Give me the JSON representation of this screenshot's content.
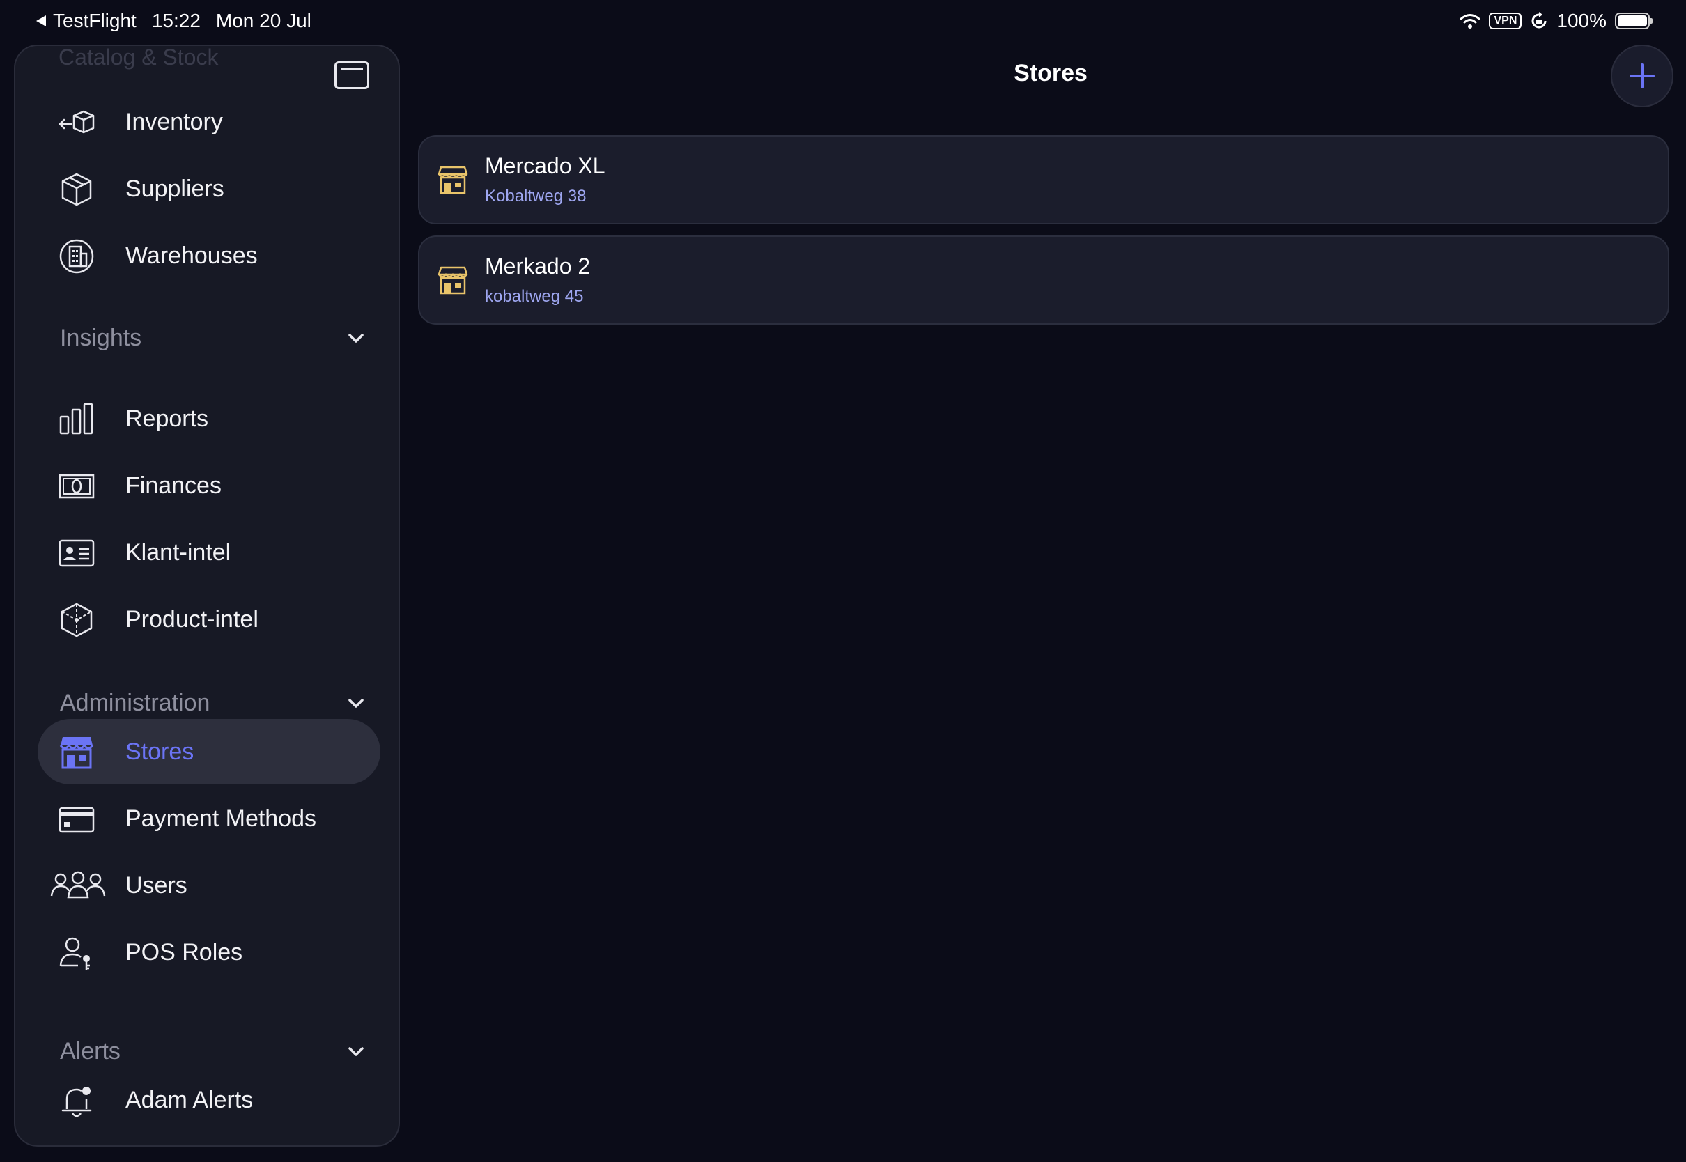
{
  "status_bar": {
    "back_app": "TestFlight",
    "time": "15:22",
    "date": "Mon 20 Jul",
    "vpn": "VPN",
    "battery": "100%"
  },
  "sidebar": {
    "ghost_section": "Catalog & Stock",
    "top_items": [
      {
        "label": "Inventory",
        "icon": "box-arrow-icon"
      },
      {
        "label": "Suppliers",
        "icon": "cube-icon"
      },
      {
        "label": "Warehouses",
        "icon": "building-icon"
      }
    ],
    "sections": [
      {
        "title": "Insights",
        "items": [
          {
            "label": "Reports",
            "icon": "bar-chart-icon"
          },
          {
            "label": "Finances",
            "icon": "banknote-icon"
          },
          {
            "label": "Klant-intel",
            "icon": "id-card-icon"
          },
          {
            "label": "Product-intel",
            "icon": "cube-analytics-icon"
          }
        ]
      },
      {
        "title": "Administration",
        "items": [
          {
            "label": "Stores",
            "icon": "storefront-icon",
            "active": true
          },
          {
            "label": "Payment Methods",
            "icon": "credit-card-icon"
          },
          {
            "label": "Users",
            "icon": "users-group-icon"
          },
          {
            "label": "POS Roles",
            "icon": "user-key-icon"
          }
        ]
      },
      {
        "title": "Alerts",
        "items": [
          {
            "label": "Adam Alerts",
            "icon": "bell-badge-icon"
          }
        ]
      }
    ]
  },
  "main": {
    "title": "Stores",
    "stores": [
      {
        "name": "Mercado XL",
        "address": "Kobaltweg 38"
      },
      {
        "name": "Merkado 2",
        "address": "kobaltweg 45"
      }
    ]
  },
  "colors": {
    "background": "#0b0c18",
    "sidebar": "#171925",
    "accent": "#6b74f5",
    "store_icon": "#e9c46a",
    "address_text": "#9ea6f0"
  }
}
